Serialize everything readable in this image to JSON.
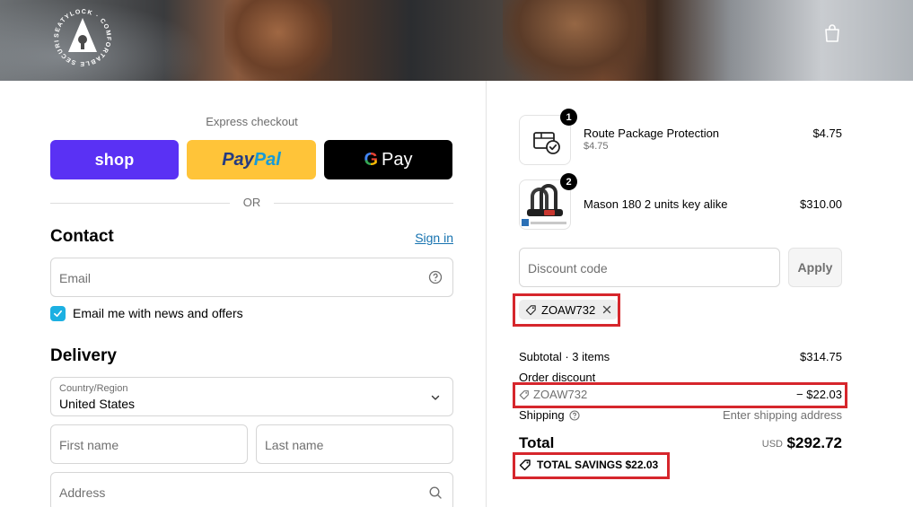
{
  "header": {
    "brand_ring_text": "SEATYLOCK · COMFORTABLE SECURITY",
    "cart_icon": "shopping-bag-icon"
  },
  "express": {
    "title": "Express checkout",
    "shop_label": "shop",
    "paypal_label_a": "Pay",
    "paypal_label_b": "Pal",
    "gpay_g": "G",
    "gpay_label": "Pay",
    "or_label": "OR",
    "colors": {
      "shop": "#5a31f4",
      "paypal": "#ffc439",
      "gpay": "#000000"
    }
  },
  "contact": {
    "title": "Contact",
    "sign_in": "Sign in",
    "email_placeholder": "Email",
    "newsletter_label": "Email me with news and offers",
    "newsletter_checked": true
  },
  "delivery": {
    "title": "Delivery",
    "country_label": "Country/Region",
    "country_value": "United States",
    "first_name_placeholder": "First name",
    "last_name_placeholder": "Last name",
    "address_placeholder": "Address"
  },
  "order": {
    "items": [
      {
        "qty": "1",
        "name": "Route Package Protection",
        "sub": "$4.75",
        "price": "$4.75",
        "icon": "package-check-icon"
      },
      {
        "qty": "2",
        "name": "Mason 180 2 units key alike",
        "sub": "",
        "price": "$310.00",
        "icon": "u-lock-icon"
      }
    ],
    "discount_placeholder": "Discount code",
    "apply_label": "Apply",
    "applied_code": "ZOAW732",
    "subtotal_label": "Subtotal · 3 items",
    "subtotal_value": "$314.75",
    "order_discount_label": "Order discount",
    "order_discount_code": "ZOAW732",
    "order_discount_value": "− $22.03",
    "shipping_label": "Shipping",
    "shipping_value": "Enter shipping address",
    "total_label": "Total",
    "total_currency": "USD",
    "total_value": "$292.72",
    "savings_label": "TOTAL SAVINGS",
    "savings_value": "$22.03",
    "highlight_color": "#d6262c"
  }
}
